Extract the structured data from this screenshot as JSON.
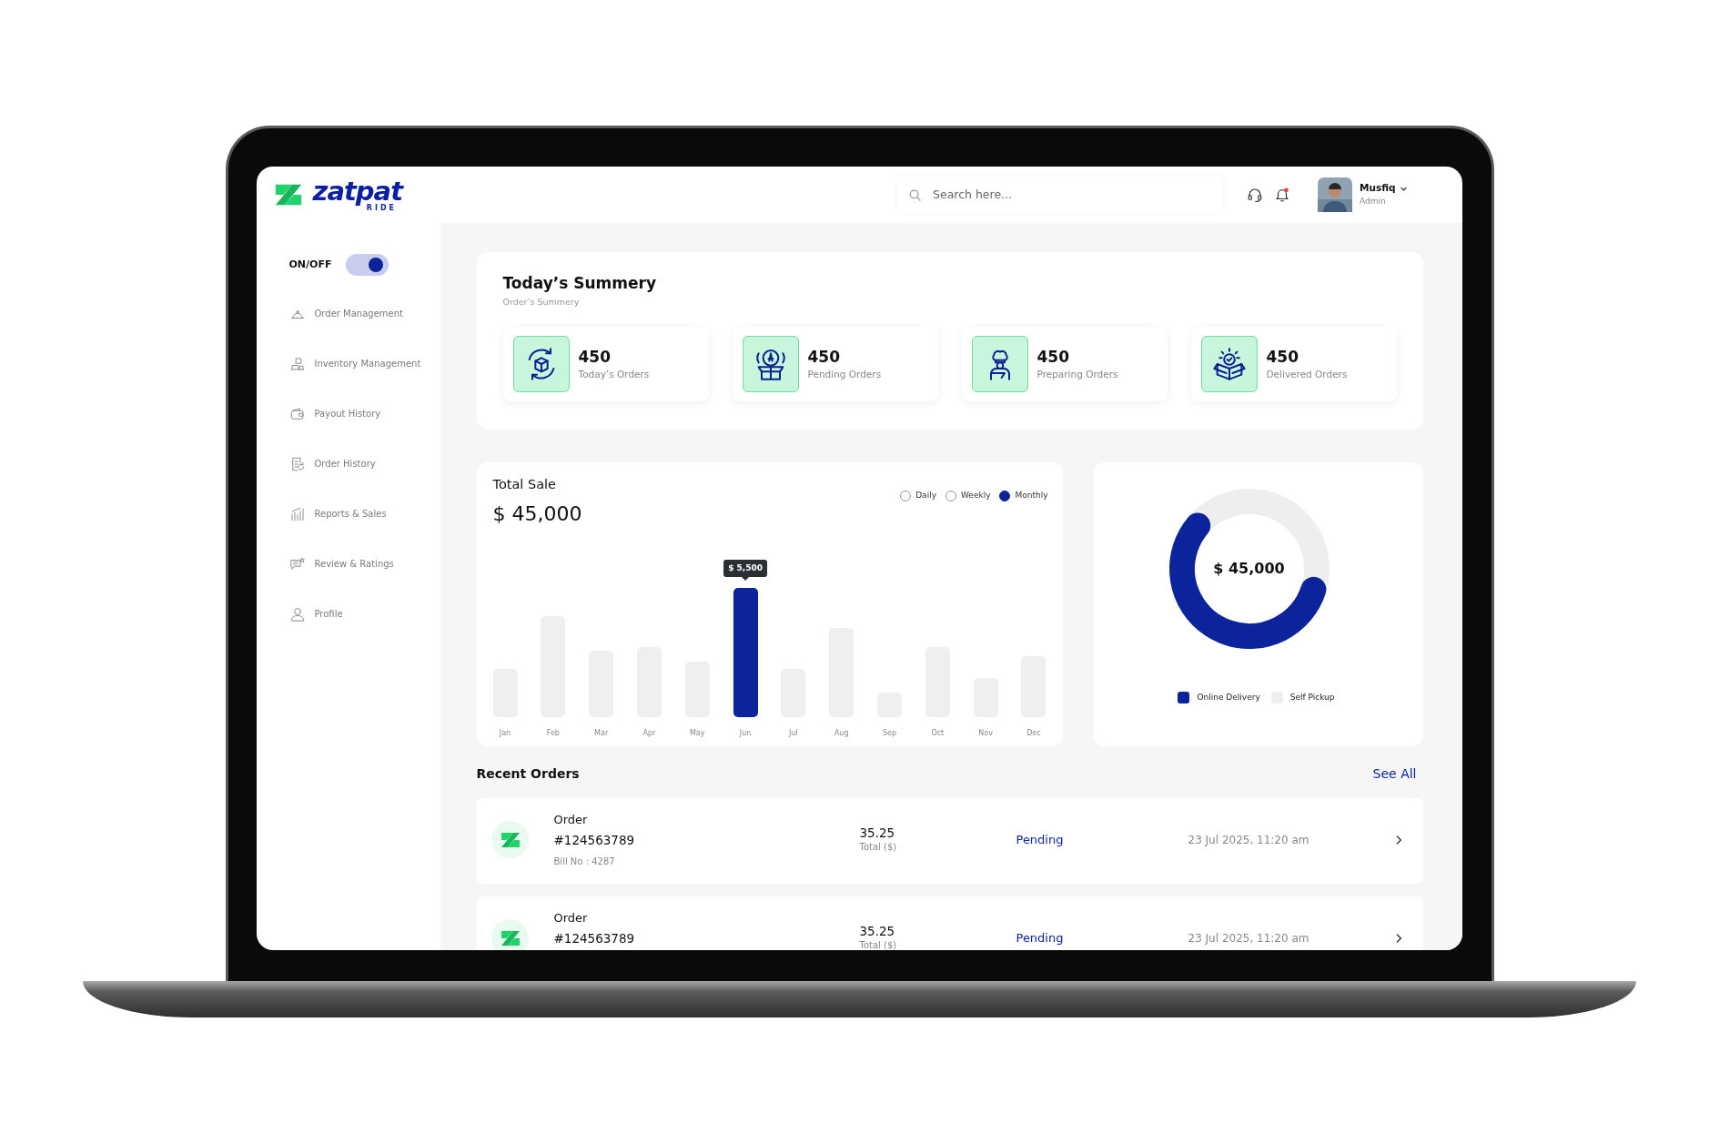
{
  "brand": {
    "name": "zatpat",
    "tagline": "RIDE"
  },
  "search": {
    "placeholder": "Search here..."
  },
  "notifications": {
    "unread": true
  },
  "user": {
    "name": "Musfiq",
    "role": "Admin"
  },
  "sidebar": {
    "toggle": {
      "label": "ON/OFF",
      "on": true
    },
    "items": [
      {
        "label": "Order Management"
      },
      {
        "label": "Inventory Management"
      },
      {
        "label": "Payout History"
      },
      {
        "label": "Order History"
      },
      {
        "label": "Reports & Sales"
      },
      {
        "label": "Review & Ratings"
      },
      {
        "label": "Profile"
      }
    ]
  },
  "summary": {
    "title": "Today’s Summery",
    "subtitle": "Order’s Summery",
    "stats": [
      {
        "value": "450",
        "label": "Today’s Orders"
      },
      {
        "value": "450",
        "label": "Pending Orders"
      },
      {
        "value": "450",
        "label": "Preparing Orders"
      },
      {
        "value": "450",
        "label": "Delivered Orders"
      }
    ]
  },
  "sales": {
    "title": "Total Sale",
    "amount": "$ 45,000",
    "periods": [
      {
        "label": "Daily",
        "selected": false
      },
      {
        "label": "Weekly",
        "selected": false
      },
      {
        "label": "Monthly",
        "selected": true
      }
    ],
    "months": [
      {
        "label": "Jan",
        "selected": false
      },
      {
        "label": "Feb",
        "selected": false
      },
      {
        "label": "Mar",
        "selected": false
      },
      {
        "label": "Apr",
        "selected": false
      },
      {
        "label": "May",
        "selected": false
      },
      {
        "label": "Jun",
        "selected": true,
        "tooltip": "$ 5,500"
      },
      {
        "label": "Jul",
        "selected": false
      },
      {
        "label": "Aug",
        "selected": false
      },
      {
        "label": "Sep",
        "selected": false
      },
      {
        "label": "Oct",
        "selected": false
      },
      {
        "label": "Nov",
        "selected": false
      },
      {
        "label": "Dec",
        "selected": false
      }
    ]
  },
  "split": {
    "total": "$ 45,000",
    "legend": [
      {
        "label": "Online Delivery",
        "color": "#0b249b"
      },
      {
        "label": "Self Pickup",
        "color": "#eeeeee"
      }
    ]
  },
  "recent_orders": {
    "title": "Recent Orders",
    "link": "See All",
    "orders": [
      {
        "title": "Order",
        "number": "#124563789",
        "bill": "Bill No : 4287",
        "amount": "35.25",
        "amount_label": "Total ($)",
        "status": "Pending",
        "date": "23 Jul 2025, 11:20 am"
      },
      {
        "title": "Order",
        "number": "#124563789",
        "amount": "35.25",
        "amount_label": "Total ($)",
        "status": "Pending",
        "date": "23 Jul 2025, 11:20 am"
      }
    ]
  }
}
